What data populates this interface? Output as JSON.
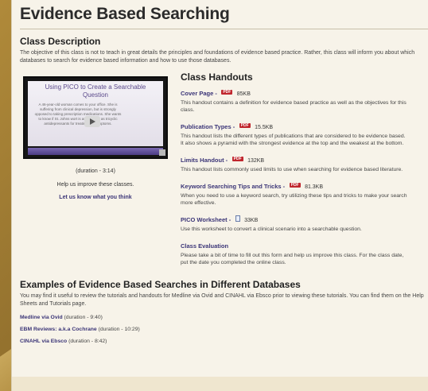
{
  "page": {
    "title": "Evidence Based Searching"
  },
  "class_description": {
    "heading": "Class Description",
    "text": "The objective of this class is not to teach in great details the principles and foundations of evidence based practice. Rather, this class will inform you about which databases to search for evidence based information and how to use those databases."
  },
  "video": {
    "slide_title": "Using PICO to Create a Searchable Question",
    "slide_body": "A 46-year-old woman comes to your office. She is suffering from clinical depression, but is strongly opposed to taking prescription medications. She wants to know if St. Johns wort is as effective as tricyclic antidepressants for treating her symptoms.",
    "duration": "(duration - 3:14)",
    "help": "Help us improve these classes.",
    "feedback_link": "Let us know what you think"
  },
  "handouts": {
    "heading": "Class Handouts",
    "items": [
      {
        "title": "Cover Page -",
        "badge": "PDF",
        "size": "85KB",
        "desc": "This handout contains a definition for evidence based practice as well as the objectives for this class."
      },
      {
        "title": "Publication Types -",
        "badge": "PDF",
        "size": "15.5KB",
        "desc": "This handout lists the different types of publications that are considered to be evidence based. It also shows a pyramid with the strongest evidence at the top and the weakest at the bottom."
      },
      {
        "title": "Limits Handout -",
        "badge": "PDF",
        "size": "132KB",
        "desc": "This handout lists commonly used limits to use when searching for evidence based literature."
      },
      {
        "title": "Keyword Searching Tips and Tricks -",
        "badge": "PDF",
        "size": "81.3KB",
        "desc": "When you need to use a keyword search, try utilizing these tips and tricks to make your search more effective."
      },
      {
        "title": "PICO Worksheet -",
        "badge": "",
        "size": "33KB",
        "desc": "Use this worksheet to convert a clinical scenario into a searchable question."
      },
      {
        "title": "Class Evaluation",
        "badge": "",
        "size": "",
        "desc": "Please take a bit of time to fill out this form and help us improve this class. For the class date, put the date you completed the online class."
      }
    ]
  },
  "examples": {
    "heading": "Examples of Evidence Based Searches in Different Databases",
    "text": "You may find it useful to review the tutorials and handouts for Medline via Ovid and CINAHL via Ebsco prior to viewing these tutorials. You can find them on the Help Sheets and Tutorials page.",
    "items": [
      {
        "link": "Medline via Ovid",
        "duration": "(duration - 9:40)"
      },
      {
        "link": "EBM Reviews: a.k.a Cochrane",
        "duration": "(duration - 10:29)"
      },
      {
        "link": "CINAHL via Ebsco",
        "duration": "(duration - 8:42)"
      }
    ]
  },
  "colors": {
    "link": "#3b3577",
    "pdf_badge": "#c0262d",
    "background": "#f7f3e9"
  }
}
